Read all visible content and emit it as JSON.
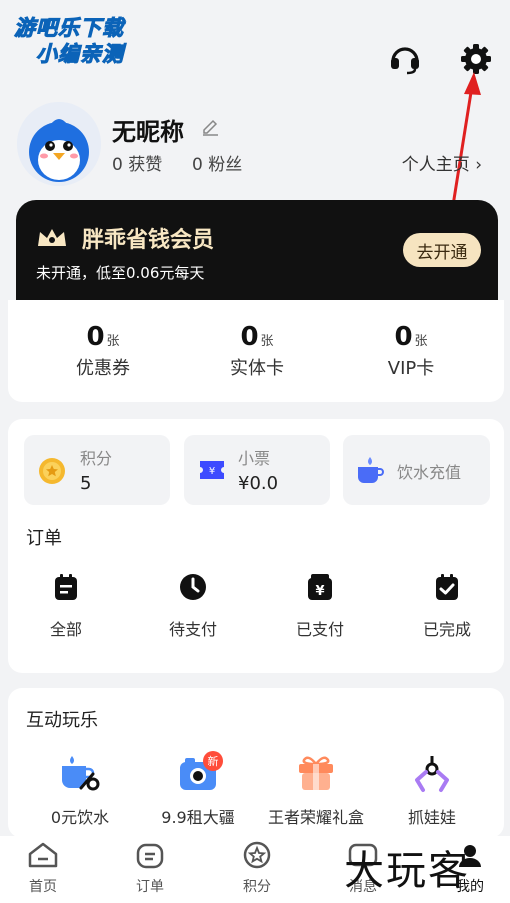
{
  "watermark": {
    "line1": "游吧乐下载",
    "line2": "小编亲测",
    "bottom": "大玩客"
  },
  "header": {
    "icons": [
      "headset-icon",
      "gear-icon"
    ]
  },
  "profile": {
    "nickname": "无昵称",
    "likes": "0 获赞",
    "fans": "0 粉丝",
    "homepage": "个人主页"
  },
  "vip": {
    "title": "胖乖省钱会员",
    "subtitle": "未开通，低至0.06元每天",
    "button": "去开通"
  },
  "assets": [
    {
      "count": "0",
      "unit": "张",
      "label": "优惠券"
    },
    {
      "count": "0",
      "unit": "张",
      "label": "实体卡"
    },
    {
      "count": "0",
      "unit": "张",
      "label": "VIP卡"
    }
  ],
  "wallet": {
    "points": {
      "label": "积分",
      "value": "5"
    },
    "ticket": {
      "label": "小票",
      "value": "¥0.0"
    },
    "water": {
      "label": "饮水充值"
    }
  },
  "orders": {
    "title": "订单",
    "items": [
      "全部",
      "待支付",
      "已支付",
      "已完成"
    ]
  },
  "fun": {
    "title": "互动玩乐",
    "badge": "新",
    "items": [
      "0元饮水",
      "9.9租大疆",
      "王者荣耀礼盒",
      "抓娃娃"
    ]
  },
  "tabs": [
    "首页",
    "订单",
    "积分",
    "消息",
    "我的"
  ],
  "colors": {
    "accent": "#3d6bff",
    "vip_bg": "#111111",
    "vip_gold": "#f6e4c0",
    "gold_coin": "#f5b82e",
    "badge": "#ff4d3a"
  }
}
